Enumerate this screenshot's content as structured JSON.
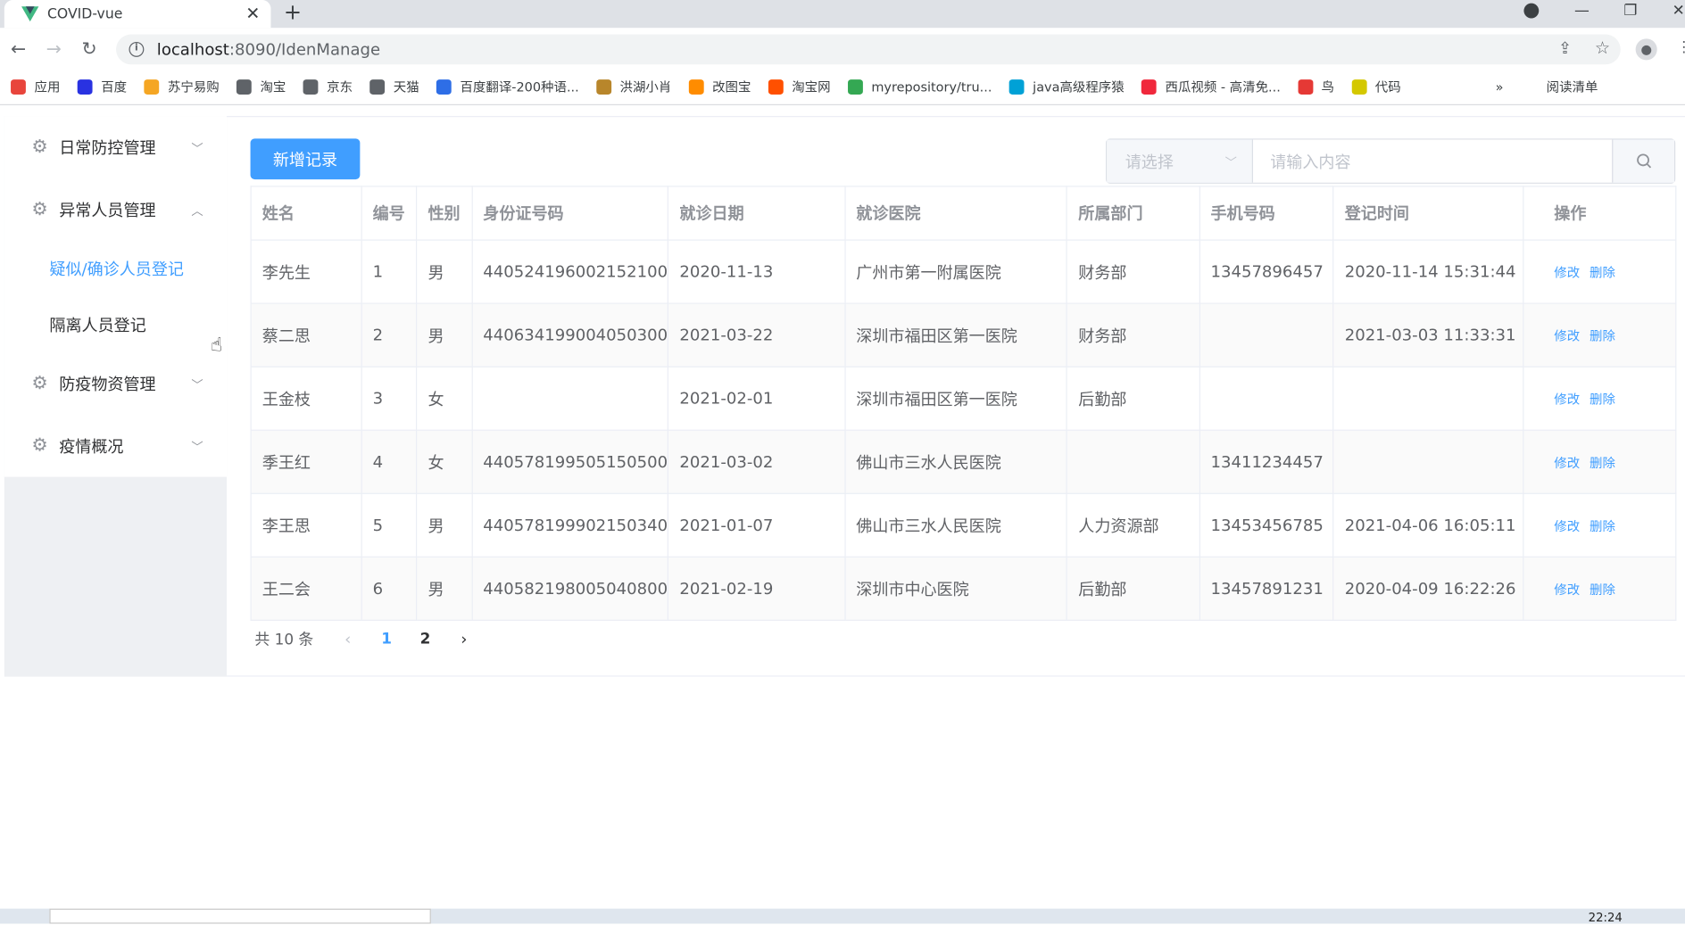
{
  "browser": {
    "tab_title": "COVID-vue",
    "close_tab": "✕",
    "new_tab": "+",
    "url_host": "localhost",
    "url_path": ":8090/IdenManage",
    "bookmarks": [
      {
        "label": "应用",
        "color": "#e8453c"
      },
      {
        "label": "百度",
        "color": "#2932e1"
      },
      {
        "label": "苏宁易购",
        "color": "#f5a623"
      },
      {
        "label": "淘宝",
        "color": "#5f6368"
      },
      {
        "label": "京东",
        "color": "#5f6368"
      },
      {
        "label": "天猫",
        "color": "#5f6368"
      },
      {
        "label": "百度翻译-200种语...",
        "color": "#2e6ee6"
      },
      {
        "label": "洪湖小肖",
        "color": "#b8862b"
      },
      {
        "label": "改图宝",
        "color": "#ff8c00"
      },
      {
        "label": "淘宝网",
        "color": "#ff5000"
      },
      {
        "label": "myrepository/tru...",
        "color": "#34a853"
      },
      {
        "label": "java高级程序猿",
        "color": "#00a1d6"
      },
      {
        "label": "西瓜视频 - 高清免...",
        "color": "#f0283c"
      },
      {
        "label": "鸟",
        "color": "#e53935"
      },
      {
        "label": "代码",
        "color": "#d4c800"
      }
    ],
    "more": "»",
    "reading_list": "阅读清单"
  },
  "sidebar": {
    "menus": [
      {
        "label": "日常防控管理",
        "chevron": "﹀"
      },
      {
        "label": "异常人员管理",
        "chevron": "︿"
      },
      {
        "label": "防疫物资管理",
        "chevron": "﹀"
      },
      {
        "label": "疫情概况",
        "chevron": "﹀"
      }
    ],
    "sub_items": [
      "疑似/确诊人员登记",
      "隔离人员登记"
    ]
  },
  "toolbar": {
    "add_label": "新增记录",
    "select_placeholder": "请选择",
    "search_placeholder": "请输入内容"
  },
  "table": {
    "headers": [
      "姓名",
      "编号",
      "性别",
      "身份证号码",
      "就诊日期",
      "就诊医院",
      "所属部门",
      "手机号码",
      "登记时间",
      "操作"
    ],
    "edit_label": "修改",
    "delete_label": "删除",
    "rows": [
      [
        "李先生",
        "1",
        "男",
        "440524196002152100",
        "2020-11-13",
        "广州市第一附属医院",
        "财务部",
        "13457896457",
        "2020-11-14 15:31:44"
      ],
      [
        "蔡二思",
        "2",
        "男",
        "440634199004050300",
        "2021-03-22",
        "深圳市福田区第一医院",
        "财务部",
        "",
        "2021-03-03 11:33:31"
      ],
      [
        "王金枝",
        "3",
        "女",
        "",
        "2021-02-01",
        "深圳市福田区第一医院",
        "后勤部",
        "",
        ""
      ],
      [
        "季王红",
        "4",
        "女",
        "440578199505150500",
        "2021-03-02",
        "佛山市三水人民医院",
        "",
        "13411234457",
        ""
      ],
      [
        "李王思",
        "5",
        "男",
        "440578199902150340",
        "2021-01-07",
        "佛山市三水人民医院",
        "人力资源部",
        "13453456785",
        "2021-04-06 16:05:11"
      ],
      [
        "王二会",
        "6",
        "男",
        "440582198005040800",
        "2021-02-19",
        "深圳市中心医院",
        "后勤部",
        "13457891231",
        "2020-04-09 16:22:26"
      ]
    ]
  },
  "pagination": {
    "total": "共 10 条",
    "prev": "‹",
    "next": "›",
    "pages": [
      "1",
      "2"
    ],
    "current": "1"
  },
  "taskbar": {
    "clock": "22:24"
  }
}
